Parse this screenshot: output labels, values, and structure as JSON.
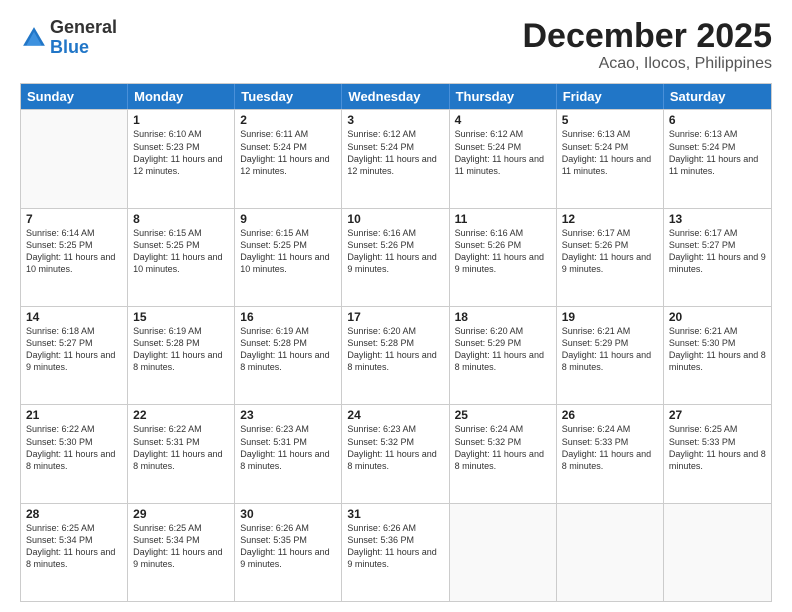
{
  "logo": {
    "general": "General",
    "blue": "Blue"
  },
  "title": "December 2025",
  "location": "Acao, Ilocos, Philippines",
  "days_of_week": [
    "Sunday",
    "Monday",
    "Tuesday",
    "Wednesday",
    "Thursday",
    "Friday",
    "Saturday"
  ],
  "weeks": [
    [
      {
        "day": "",
        "empty": true
      },
      {
        "day": "1",
        "sunrise": "Sunrise: 6:10 AM",
        "sunset": "Sunset: 5:23 PM",
        "daylight": "Daylight: 11 hours and 12 minutes."
      },
      {
        "day": "2",
        "sunrise": "Sunrise: 6:11 AM",
        "sunset": "Sunset: 5:24 PM",
        "daylight": "Daylight: 11 hours and 12 minutes."
      },
      {
        "day": "3",
        "sunrise": "Sunrise: 6:12 AM",
        "sunset": "Sunset: 5:24 PM",
        "daylight": "Daylight: 11 hours and 12 minutes."
      },
      {
        "day": "4",
        "sunrise": "Sunrise: 6:12 AM",
        "sunset": "Sunset: 5:24 PM",
        "daylight": "Daylight: 11 hours and 11 minutes."
      },
      {
        "day": "5",
        "sunrise": "Sunrise: 6:13 AM",
        "sunset": "Sunset: 5:24 PM",
        "daylight": "Daylight: 11 hours and 11 minutes."
      },
      {
        "day": "6",
        "sunrise": "Sunrise: 6:13 AM",
        "sunset": "Sunset: 5:24 PM",
        "daylight": "Daylight: 11 hours and 11 minutes."
      }
    ],
    [
      {
        "day": "7",
        "sunrise": "Sunrise: 6:14 AM",
        "sunset": "Sunset: 5:25 PM",
        "daylight": "Daylight: 11 hours and 10 minutes."
      },
      {
        "day": "8",
        "sunrise": "Sunrise: 6:15 AM",
        "sunset": "Sunset: 5:25 PM",
        "daylight": "Daylight: 11 hours and 10 minutes."
      },
      {
        "day": "9",
        "sunrise": "Sunrise: 6:15 AM",
        "sunset": "Sunset: 5:25 PM",
        "daylight": "Daylight: 11 hours and 10 minutes."
      },
      {
        "day": "10",
        "sunrise": "Sunrise: 6:16 AM",
        "sunset": "Sunset: 5:26 PM",
        "daylight": "Daylight: 11 hours and 9 minutes."
      },
      {
        "day": "11",
        "sunrise": "Sunrise: 6:16 AM",
        "sunset": "Sunset: 5:26 PM",
        "daylight": "Daylight: 11 hours and 9 minutes."
      },
      {
        "day": "12",
        "sunrise": "Sunrise: 6:17 AM",
        "sunset": "Sunset: 5:26 PM",
        "daylight": "Daylight: 11 hours and 9 minutes."
      },
      {
        "day": "13",
        "sunrise": "Sunrise: 6:17 AM",
        "sunset": "Sunset: 5:27 PM",
        "daylight": "Daylight: 11 hours and 9 minutes."
      }
    ],
    [
      {
        "day": "14",
        "sunrise": "Sunrise: 6:18 AM",
        "sunset": "Sunset: 5:27 PM",
        "daylight": "Daylight: 11 hours and 9 minutes."
      },
      {
        "day": "15",
        "sunrise": "Sunrise: 6:19 AM",
        "sunset": "Sunset: 5:28 PM",
        "daylight": "Daylight: 11 hours and 8 minutes."
      },
      {
        "day": "16",
        "sunrise": "Sunrise: 6:19 AM",
        "sunset": "Sunset: 5:28 PM",
        "daylight": "Daylight: 11 hours and 8 minutes."
      },
      {
        "day": "17",
        "sunrise": "Sunrise: 6:20 AM",
        "sunset": "Sunset: 5:28 PM",
        "daylight": "Daylight: 11 hours and 8 minutes."
      },
      {
        "day": "18",
        "sunrise": "Sunrise: 6:20 AM",
        "sunset": "Sunset: 5:29 PM",
        "daylight": "Daylight: 11 hours and 8 minutes."
      },
      {
        "day": "19",
        "sunrise": "Sunrise: 6:21 AM",
        "sunset": "Sunset: 5:29 PM",
        "daylight": "Daylight: 11 hours and 8 minutes."
      },
      {
        "day": "20",
        "sunrise": "Sunrise: 6:21 AM",
        "sunset": "Sunset: 5:30 PM",
        "daylight": "Daylight: 11 hours and 8 minutes."
      }
    ],
    [
      {
        "day": "21",
        "sunrise": "Sunrise: 6:22 AM",
        "sunset": "Sunset: 5:30 PM",
        "daylight": "Daylight: 11 hours and 8 minutes."
      },
      {
        "day": "22",
        "sunrise": "Sunrise: 6:22 AM",
        "sunset": "Sunset: 5:31 PM",
        "daylight": "Daylight: 11 hours and 8 minutes."
      },
      {
        "day": "23",
        "sunrise": "Sunrise: 6:23 AM",
        "sunset": "Sunset: 5:31 PM",
        "daylight": "Daylight: 11 hours and 8 minutes."
      },
      {
        "day": "24",
        "sunrise": "Sunrise: 6:23 AM",
        "sunset": "Sunset: 5:32 PM",
        "daylight": "Daylight: 11 hours and 8 minutes."
      },
      {
        "day": "25",
        "sunrise": "Sunrise: 6:24 AM",
        "sunset": "Sunset: 5:32 PM",
        "daylight": "Daylight: 11 hours and 8 minutes."
      },
      {
        "day": "26",
        "sunrise": "Sunrise: 6:24 AM",
        "sunset": "Sunset: 5:33 PM",
        "daylight": "Daylight: 11 hours and 8 minutes."
      },
      {
        "day": "27",
        "sunrise": "Sunrise: 6:25 AM",
        "sunset": "Sunset: 5:33 PM",
        "daylight": "Daylight: 11 hours and 8 minutes."
      }
    ],
    [
      {
        "day": "28",
        "sunrise": "Sunrise: 6:25 AM",
        "sunset": "Sunset: 5:34 PM",
        "daylight": "Daylight: 11 hours and 8 minutes."
      },
      {
        "day": "29",
        "sunrise": "Sunrise: 6:25 AM",
        "sunset": "Sunset: 5:34 PM",
        "daylight": "Daylight: 11 hours and 9 minutes."
      },
      {
        "day": "30",
        "sunrise": "Sunrise: 6:26 AM",
        "sunset": "Sunset: 5:35 PM",
        "daylight": "Daylight: 11 hours and 9 minutes."
      },
      {
        "day": "31",
        "sunrise": "Sunrise: 6:26 AM",
        "sunset": "Sunset: 5:36 PM",
        "daylight": "Daylight: 11 hours and 9 minutes."
      },
      {
        "day": "",
        "empty": true
      },
      {
        "day": "",
        "empty": true
      },
      {
        "day": "",
        "empty": true
      }
    ]
  ]
}
